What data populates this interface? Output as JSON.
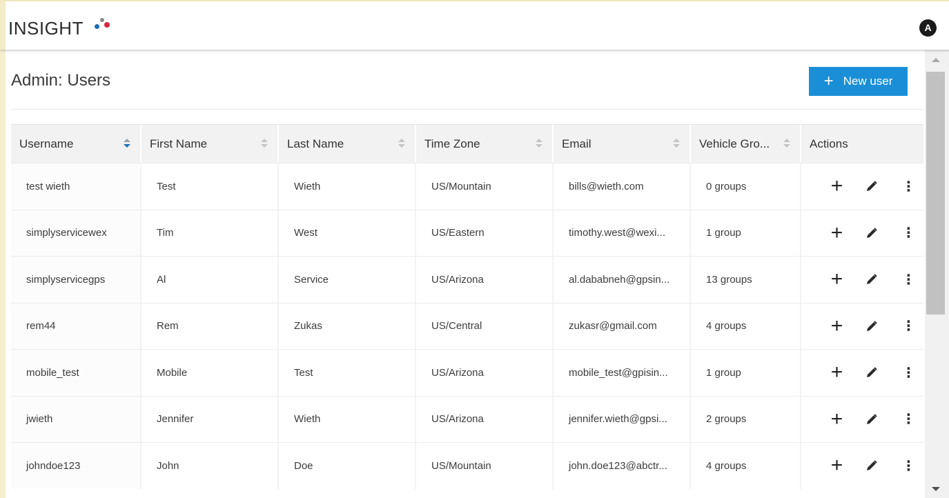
{
  "app": {
    "logo_text": "INSIGHT",
    "user_initial": "A"
  },
  "page": {
    "title": "Admin: Users",
    "new_user_label": "New user",
    "new_user_icon": "plus-icon"
  },
  "colors": {
    "accent": "#1a8fd8",
    "logo_dot_blue": "#1f6fb2",
    "logo_dot_red": "#d6263d",
    "logo_dot_gray": "#8a8a8a"
  },
  "table": {
    "columns": [
      {
        "label": "Username",
        "sortable": true,
        "sort": "descending"
      },
      {
        "label": "First Name",
        "sortable": true
      },
      {
        "label": "Last Name",
        "sortable": true
      },
      {
        "label": "Time Zone",
        "sortable": true
      },
      {
        "label": "Email",
        "sortable": true
      },
      {
        "label": "Vehicle Gro...",
        "sortable": true
      },
      {
        "label": "Actions",
        "sortable": false
      }
    ],
    "rows": [
      {
        "username": "test wieth",
        "first": "Test",
        "last": "Wieth",
        "tz": "US/Mountain",
        "email": "bills@wieth.com",
        "groups": "0 groups"
      },
      {
        "username": "simplyservicewex",
        "first": "Tim",
        "last": "West",
        "tz": "US/Eastern",
        "email": "timothy.west@wexi...",
        "groups": "1 group"
      },
      {
        "username": "simplyservicegps",
        "first": "Al",
        "last": "Service",
        "tz": "US/Arizona",
        "email": "al.dababneh@gpsin...",
        "groups": "13 groups"
      },
      {
        "username": "rem44",
        "first": "Rem",
        "last": "Zukas",
        "tz": "US/Central",
        "email": "zukasr@gmail.com",
        "groups": "4 groups"
      },
      {
        "username": "mobile_test",
        "first": "Mobile",
        "last": "Test",
        "tz": "US/Arizona",
        "email": "mobile_test@gpisin...",
        "groups": "1 group"
      },
      {
        "username": "jwieth",
        "first": "Jennifer",
        "last": "Wieth",
        "tz": "US/Arizona",
        "email": "jennifer.wieth@gpsi...",
        "groups": "2 groups"
      },
      {
        "username": "johndoe123",
        "first": "John",
        "last": "Doe",
        "tz": "US/Mountain",
        "email": "john.doe123@abctr...",
        "groups": "4 groups"
      }
    ],
    "row_actions": [
      "plus-icon",
      "pencil-icon",
      "more-vertical-icon"
    ]
  }
}
